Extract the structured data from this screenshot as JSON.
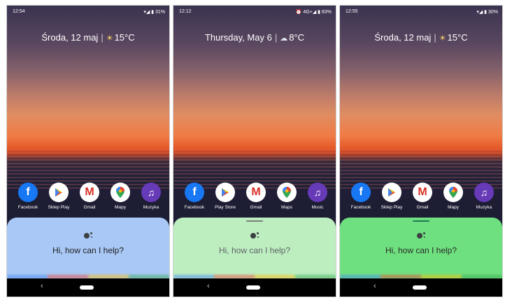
{
  "phones": [
    {
      "status": {
        "time": "12:54",
        "right": "▾◢ ▮ 31%"
      },
      "glance": {
        "date": "Środa, 12 maj",
        "temp": "15°C",
        "weather_icon": "sun-cloud-icon"
      },
      "apps": [
        {
          "label": "Facebook",
          "icon": "facebook-icon"
        },
        {
          "label": "Sklep Play",
          "icon": "play-store-icon"
        },
        {
          "label": "Gmail",
          "icon": "gmail-icon"
        },
        {
          "label": "Mapy",
          "icon": "maps-icon"
        },
        {
          "label": "Muzyka",
          "icon": "music-icon"
        }
      ],
      "assistant": {
        "greeting": "Hi, how can I help?",
        "sheet_color": "#a9c8f5",
        "text_color": "#202124"
      }
    },
    {
      "status": {
        "time": "12:12",
        "right": "⏰ 4G+◢ ▮ 83%"
      },
      "glance": {
        "date": "Thursday, May 6",
        "temp": "8°C",
        "weather_icon": "cloud-icon"
      },
      "apps": [
        {
          "label": "Facebook",
          "icon": "facebook-icon"
        },
        {
          "label": "Play Store",
          "icon": "play-store-icon"
        },
        {
          "label": "Gmail",
          "icon": "gmail-icon"
        },
        {
          "label": "Maps",
          "icon": "maps-icon"
        },
        {
          "label": "Music",
          "icon": "music-icon"
        }
      ],
      "assistant": {
        "greeting": "Hi, how can I help?",
        "sheet_color": "#bdeec0",
        "text_color": "#5f6368",
        "handle_color": "#7d7d7d"
      }
    },
    {
      "status": {
        "time": "12:55",
        "right": "▾◢ ▮ 30%"
      },
      "glance": {
        "date": "Środa, 12 maj",
        "temp": "15°C",
        "weather_icon": "sun-cloud-icon"
      },
      "apps": [
        {
          "label": "Facebook",
          "icon": "facebook-icon"
        },
        {
          "label": "Sklep Play",
          "icon": "play-store-icon"
        },
        {
          "label": "Gmail",
          "icon": "gmail-icon"
        },
        {
          "label": "Mapy",
          "icon": "maps-icon"
        },
        {
          "label": "Muzyka",
          "icon": "music-icon"
        }
      ],
      "assistant": {
        "greeting": "Hi, how can I help?",
        "sheet_color": "#6fe07f",
        "text_color": "#2a2a2a",
        "handle_color": "#1f7a55"
      }
    }
  ],
  "nav": {
    "back_glyph": "‹"
  }
}
